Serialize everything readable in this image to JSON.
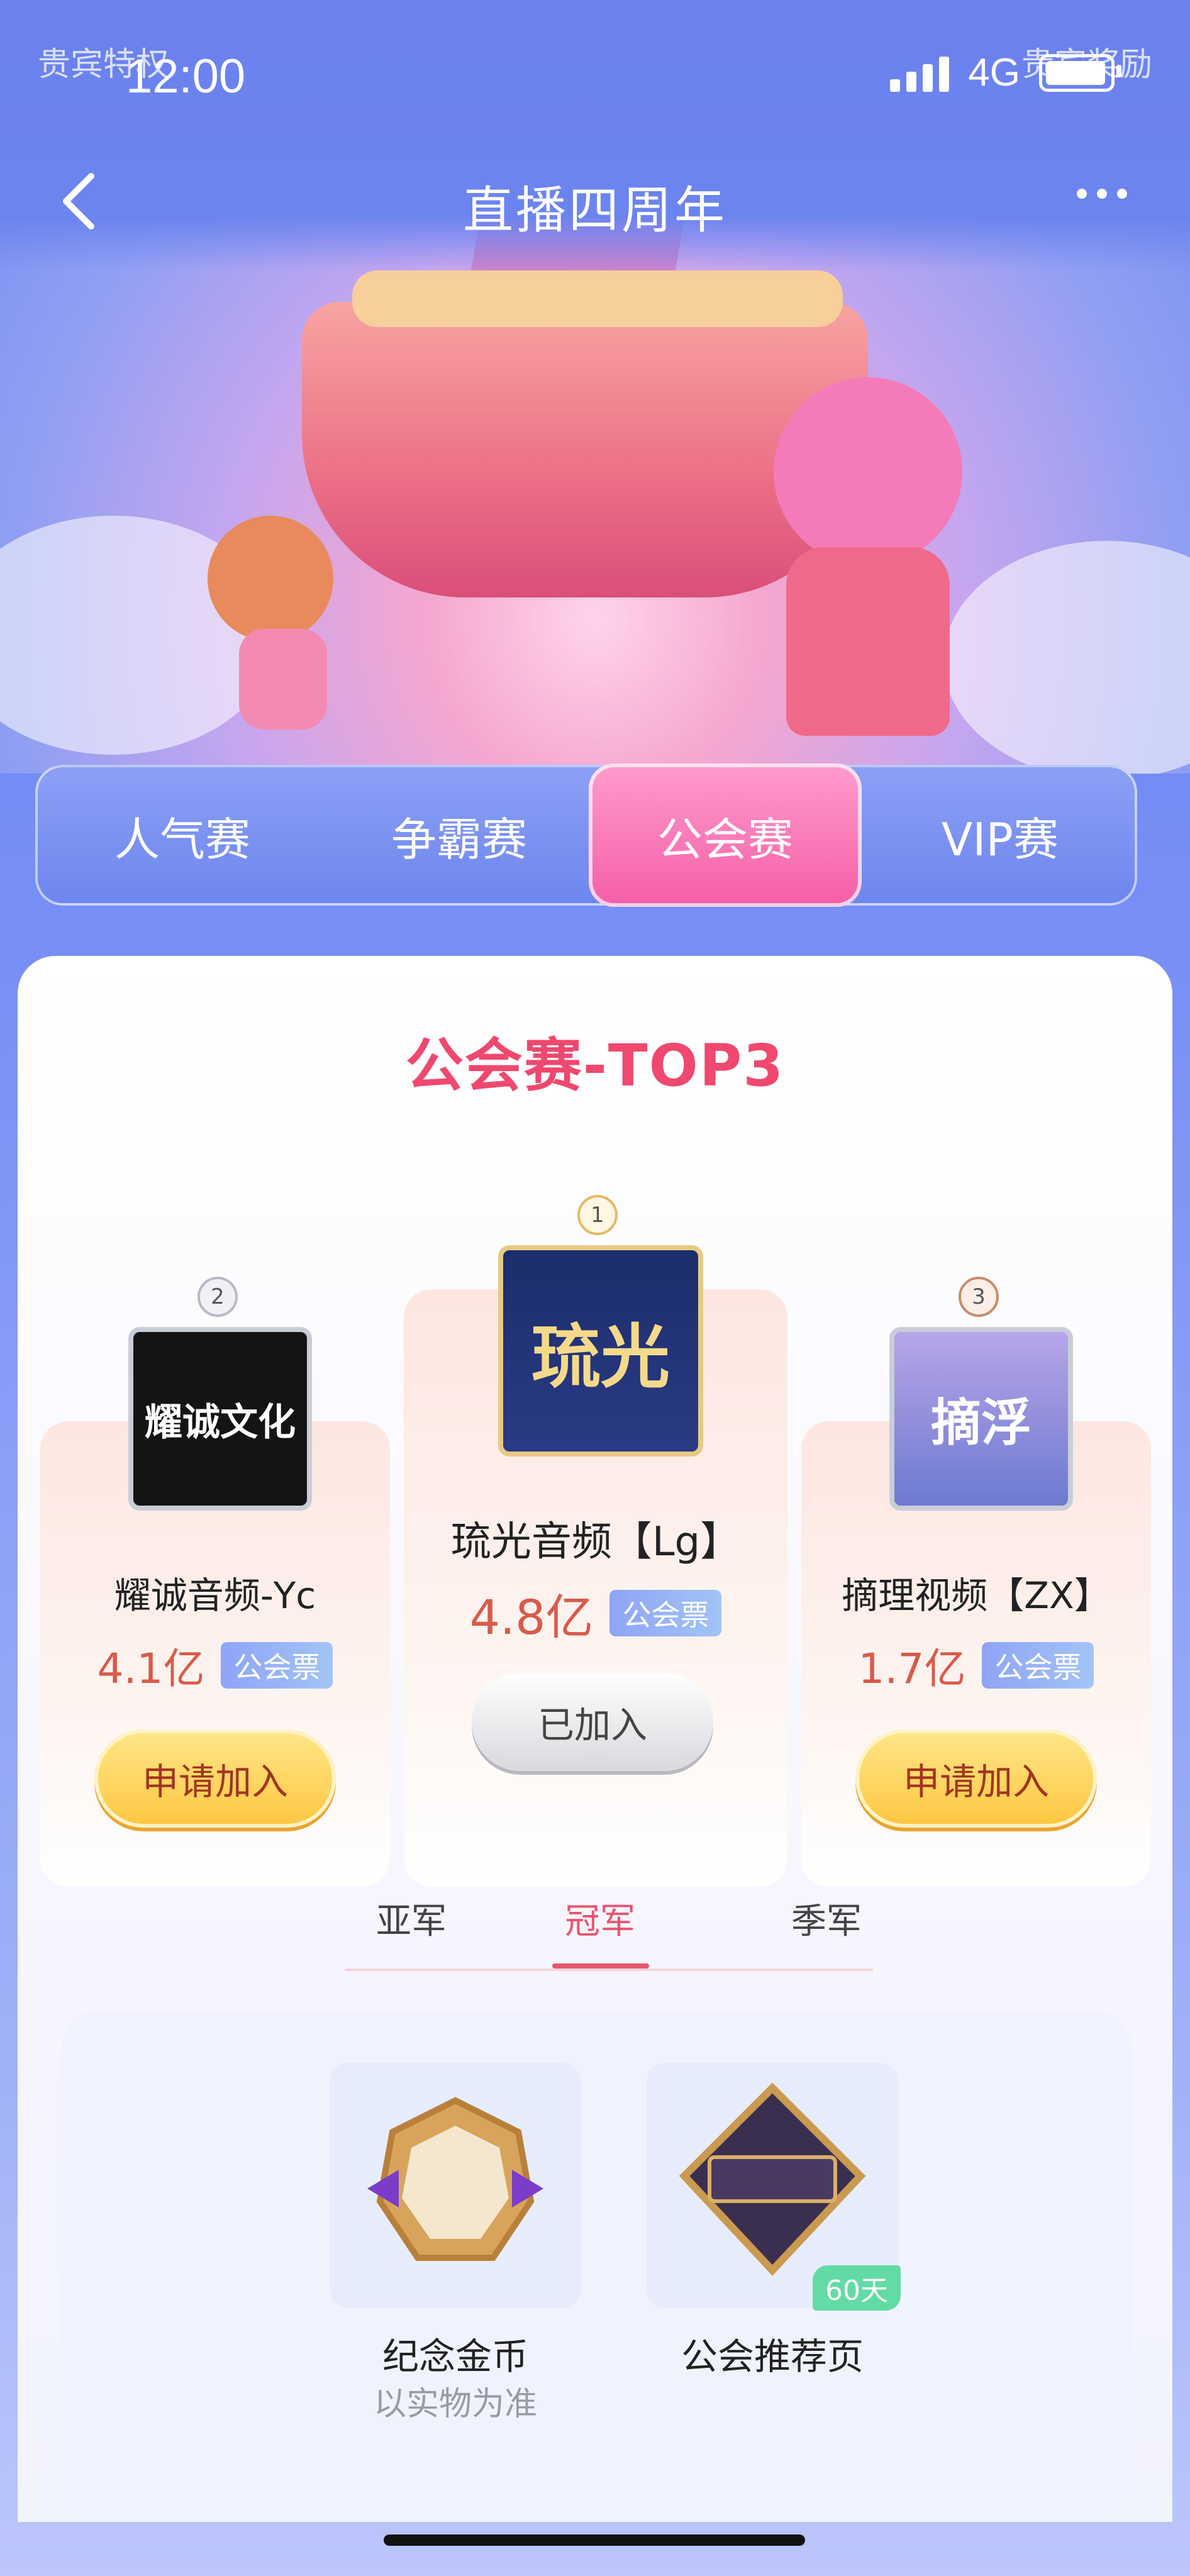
{
  "status_bar": {
    "time": "12:00",
    "network": "4G"
  },
  "header": {
    "title": "直播四周年",
    "back_icon": "chevron-left-icon",
    "more_icon": "more-dots-icon",
    "corner_left": "贵宾特权",
    "corner_right": "贵宾奖励"
  },
  "tabs": [
    {
      "label": "人气赛",
      "active": false
    },
    {
      "label": "争霸赛",
      "active": false
    },
    {
      "label": "公会赛",
      "active": true
    },
    {
      "label": "VIP赛",
      "active": false
    }
  ],
  "section": {
    "title": "公会赛-TOP3"
  },
  "ranking": [
    {
      "rank": "2",
      "avatar_text": "耀诚文化",
      "name": "耀诚音频-Yc",
      "score": "4.1亿",
      "tag": "公会票",
      "button": "申请加入",
      "joined": false
    },
    {
      "rank": "1",
      "avatar_text": "琉光",
      "name": "琉光音频【Lg】",
      "score": "4.8亿",
      "tag": "公会票",
      "button": "已加入",
      "joined": true
    },
    {
      "rank": "3",
      "avatar_text": "摘浮",
      "name": "摘理视频【ZX】",
      "score": "1.7亿",
      "tag": "公会票",
      "button": "申请加入",
      "joined": false
    }
  ],
  "sub_tabs": [
    {
      "label": "亚军",
      "active": false
    },
    {
      "label": "冠军",
      "active": true
    },
    {
      "label": "季军",
      "active": false
    }
  ],
  "rewards": [
    {
      "name": "纪念金币",
      "note": "以实物为准",
      "icon": "commemorative-coin-icon",
      "badge": ""
    },
    {
      "name": "公会推荐页",
      "note": "",
      "icon": "recommend-page-icon",
      "badge": "60天"
    }
  ],
  "colors": {
    "accent": "#f0486e",
    "tab_active": "#f55ea7",
    "background": "#6f86f0"
  }
}
